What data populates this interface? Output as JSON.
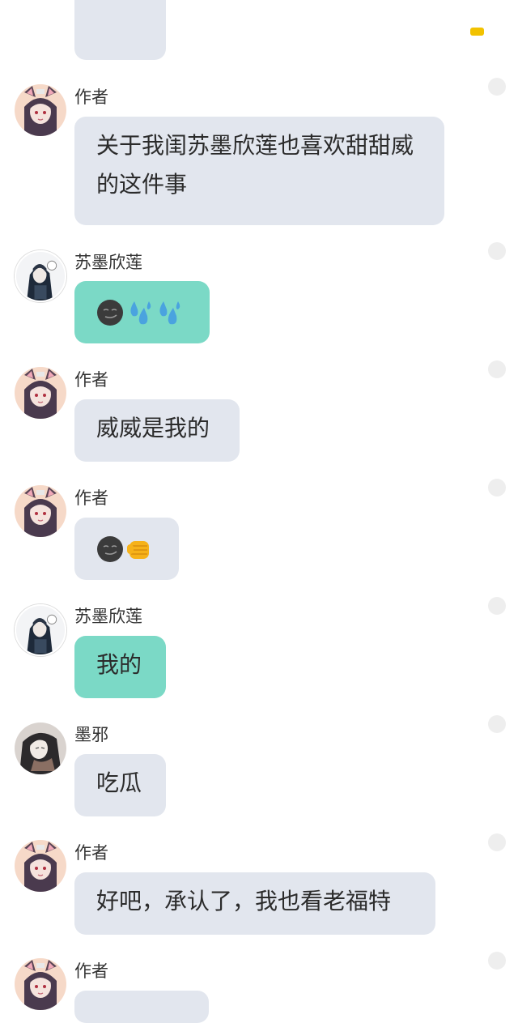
{
  "colors": {
    "bubble_gray": "#e2e6ee",
    "bubble_teal": "#7bd9c6",
    "indicator": "#f2c200"
  },
  "messages": [
    {
      "sender": "作者",
      "text": "关于我闺苏墨欣莲也喜欢甜甜威的这件事",
      "style": "gray",
      "avatar": "author-avatar"
    },
    {
      "sender": "苏墨欣莲",
      "text": "",
      "emojis": [
        "smirk-face",
        "sweat-droplets",
        "sweat-droplets"
      ],
      "style": "teal",
      "avatar": "sumo-avatar"
    },
    {
      "sender": "作者",
      "text": "威威是我的",
      "style": "gray",
      "avatar": "author-avatar"
    },
    {
      "sender": "作者",
      "text": "",
      "emojis": [
        "smirk-face",
        "fist-bump"
      ],
      "style": "gray",
      "avatar": "author-avatar"
    },
    {
      "sender": "苏墨欣莲",
      "text": "我的",
      "style": "teal",
      "avatar": "sumo-avatar"
    },
    {
      "sender": "墨邪",
      "text": "吃瓜",
      "style": "gray",
      "avatar": "moxie-avatar"
    },
    {
      "sender": "作者",
      "text": "好吧，承认了，我也看老福特",
      "style": "gray",
      "avatar": "author-avatar"
    },
    {
      "sender": "作者",
      "text": "",
      "style": "gray",
      "avatar": "author-avatar"
    }
  ]
}
